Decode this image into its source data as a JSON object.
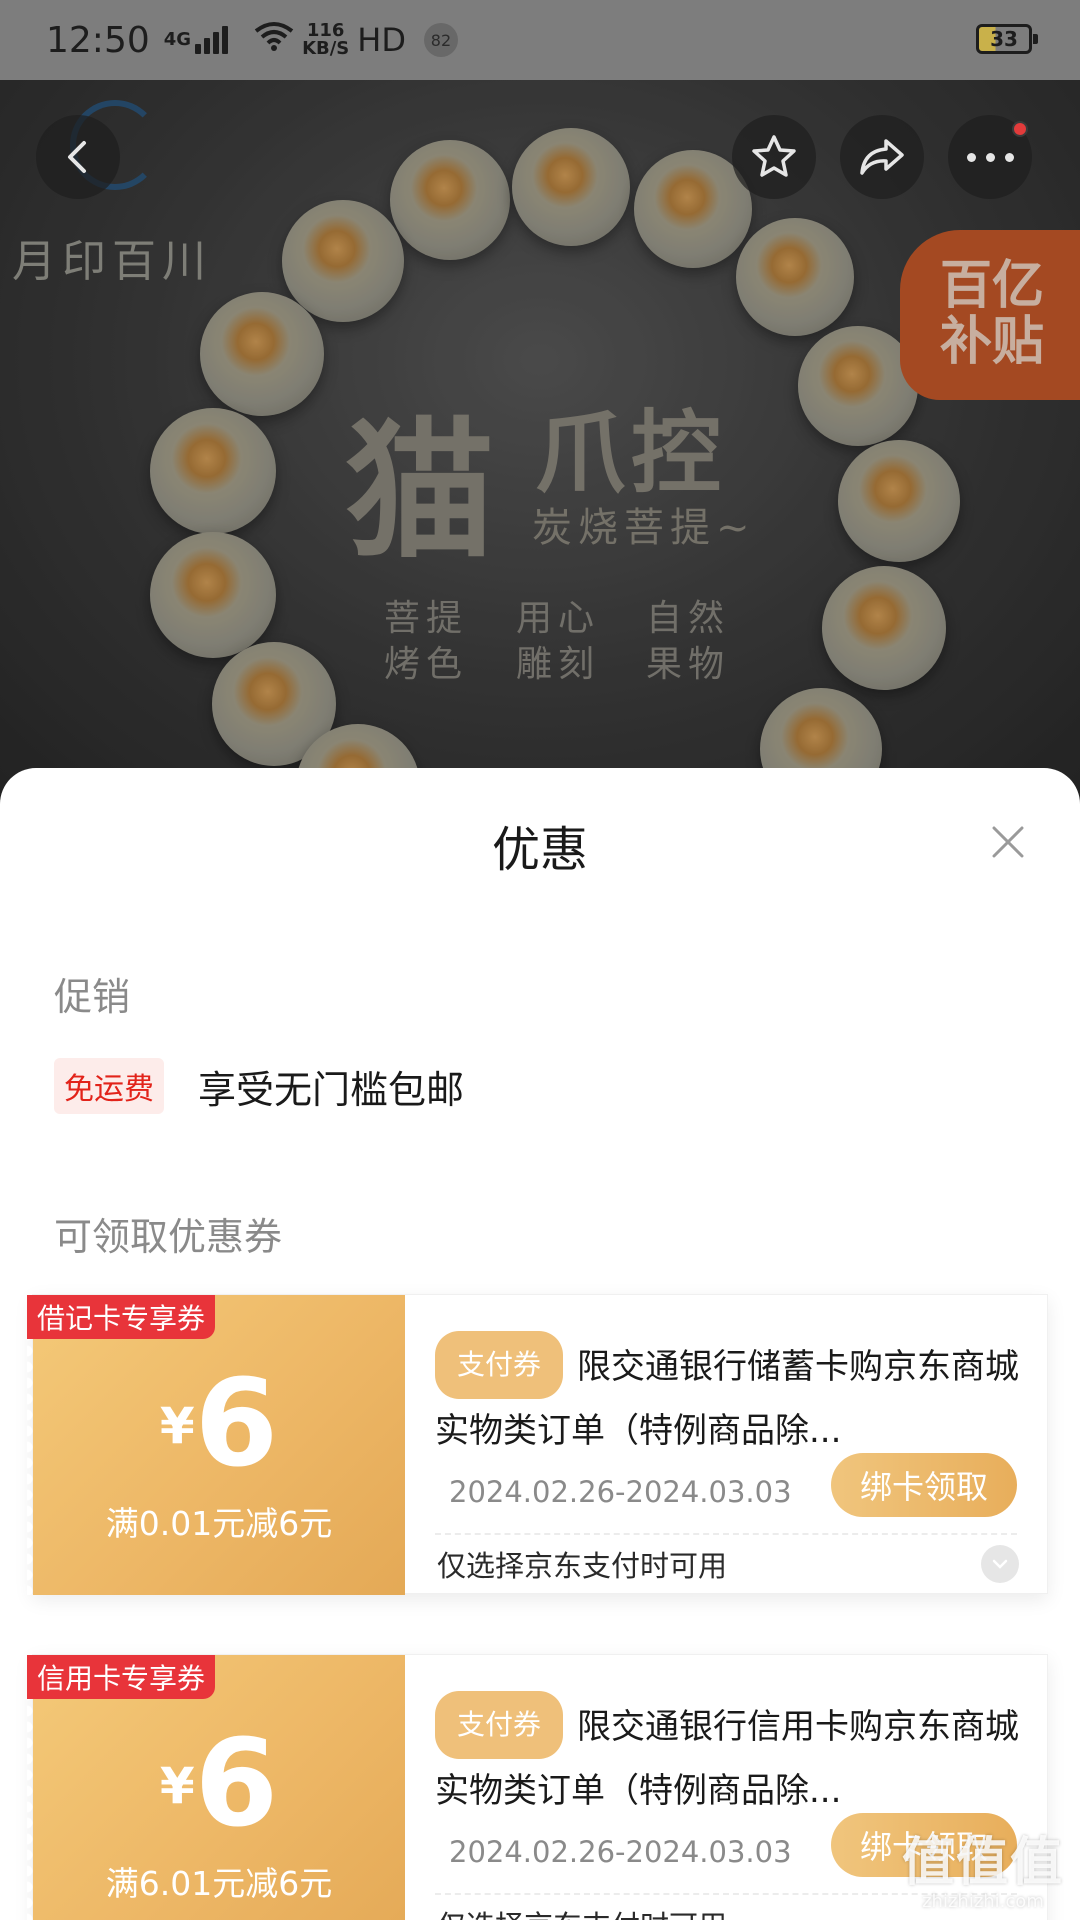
{
  "status_bar": {
    "time": "12:50",
    "network": "4G",
    "speed_value": "116",
    "speed_unit": "KB/S",
    "hd": "HD",
    "notification_count": "82",
    "battery": "33"
  },
  "hero": {
    "brand": "月印百川",
    "title_big": "猫",
    "title_small": "爪控",
    "subtitle": "炭烧菩提~",
    "tags": [
      "菩提\n烤色",
      "用心\n雕刻",
      "自然\n果物"
    ],
    "subsidy_badge": "百亿\n补贴"
  },
  "top_bar": {
    "back_icon": "chevron-left-icon",
    "favorite_icon": "star-icon",
    "share_icon": "share-icon",
    "more_icon": "more-dots-icon"
  },
  "sheet": {
    "title": "优惠",
    "promo_section": "促销",
    "promo": {
      "tag": "免运费",
      "text": "享受无门槛包邮"
    },
    "coupon_section": "可领取优惠券",
    "coupons": [
      {
        "ribbon": "借记卡专享券",
        "currency": "¥",
        "amount": "6",
        "condition": "满0.01元减6元",
        "type_tag": "支付券",
        "desc": "限交通银行储蓄卡购京东商城实物类订单（特例商品除...",
        "date": "2024.02.26-2024.03.03",
        "button": "绑卡领取",
        "note": "仅选择京东支付时可用"
      },
      {
        "ribbon": "信用卡专享券",
        "currency": "¥",
        "amount": "6",
        "condition": "满6.01元减6元",
        "type_tag": "支付券",
        "desc": "限交通银行信用卡购京东商城实物类订单（特例商品除...",
        "date": "2024.02.26-2024.03.03",
        "button": "绑卡领取",
        "note": "仅选择京东支付时可用"
      }
    ]
  },
  "watermark": {
    "main": "值值值",
    "sub": "zhizhizhi.com"
  }
}
